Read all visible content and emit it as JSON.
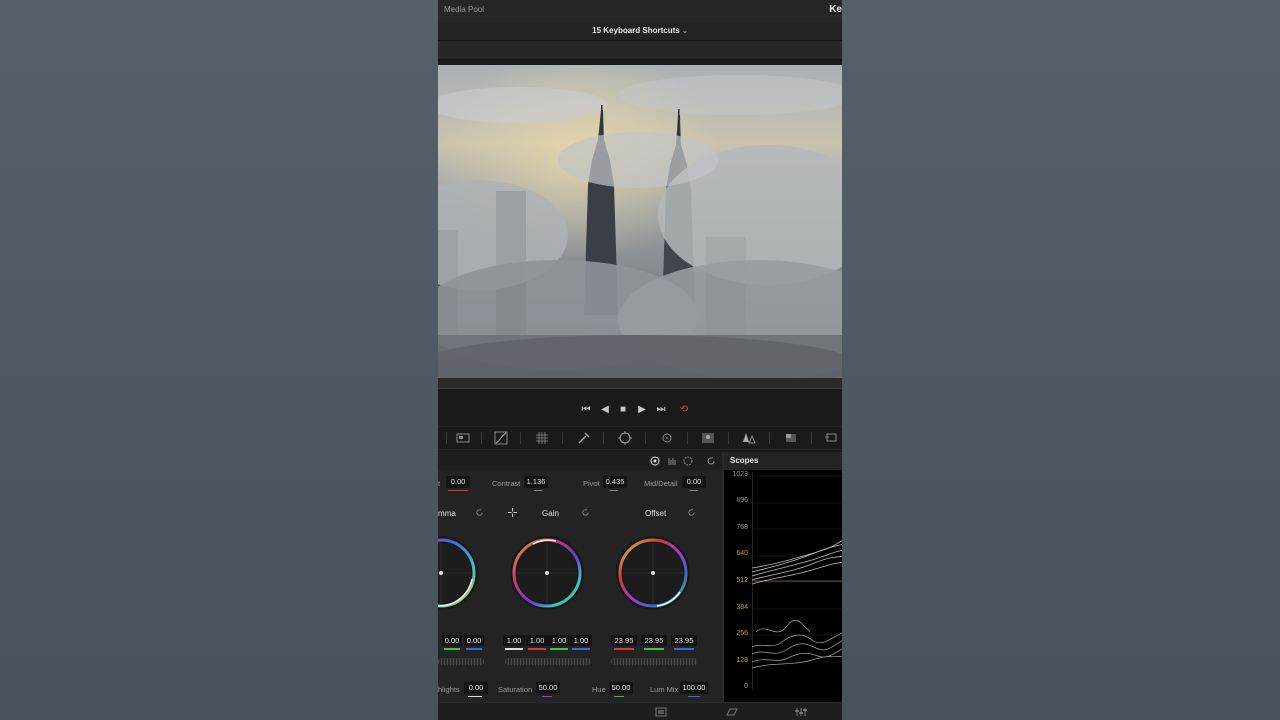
{
  "app": {
    "media_pool_label": "Media Pool",
    "top_right_text": "Ke",
    "timeline_title": "15 Keyboard Shortcuts",
    "timeline_dropdown_icon": "chevron-down-icon"
  },
  "transport": {
    "buttons": [
      "skip-to-start-icon",
      "play-reverse-icon",
      "stop-icon",
      "play-icon",
      "skip-to-end-icon",
      "loop-icon"
    ],
    "loop_color": "#e0413a"
  },
  "primaries": {
    "lift_label_partial": "t",
    "lift_value": "0.00",
    "contrast_label": "Contrast",
    "contrast_value": "1.136",
    "pivot_label": "Pivot",
    "pivot_value": "0.435",
    "mid_detail_label": "Mid/Detail",
    "mid_detail_value": "0.00",
    "wheels": [
      {
        "label": "mma",
        "values": [
          "0.00",
          "0.00"
        ]
      },
      {
        "label": "Gain",
        "values": [
          "1.00",
          "1.00",
          "1.00",
          "1.00"
        ]
      },
      {
        "label": "Offset",
        "values": [
          "23.95",
          "23.95",
          "23.95"
        ]
      }
    ],
    "highlights_label": "hlights",
    "highlights_value": "0.00",
    "saturation_label": "Saturation",
    "saturation_value": "50.00",
    "hue_label": "Hue",
    "hue_value": "50.00",
    "lum_mix_label": "Lum Mix",
    "lum_mix_value": "100.00"
  },
  "scopes": {
    "title": "Scopes",
    "scale": [
      "1023",
      "896",
      "768",
      "640",
      "512",
      "384",
      "256",
      "128",
      "0"
    ]
  },
  "colors": {
    "accent_gold": "#c8a040",
    "red_channel": "#d23a3a",
    "green_channel": "#3ac24a",
    "blue_channel": "#3a6ad2"
  }
}
